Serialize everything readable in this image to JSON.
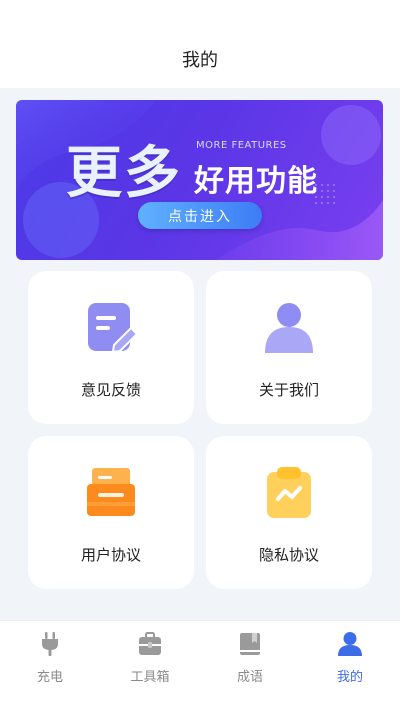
{
  "header": {
    "title": "我的"
  },
  "banner": {
    "big_text": "更多",
    "en_text": "MORE FEATURES",
    "sub_text": "好用功能",
    "button_label": "点击进入"
  },
  "cards": [
    {
      "label": "意见反馈",
      "icon": "feedback-icon"
    },
    {
      "label": "关于我们",
      "icon": "user-icon"
    },
    {
      "label": "用户协议",
      "icon": "archive-box-icon"
    },
    {
      "label": "隐私协议",
      "icon": "clipboard-chart-icon"
    }
  ],
  "tabbar": {
    "items": [
      {
        "label": "充电",
        "icon": "plug-icon",
        "active": false
      },
      {
        "label": "工具箱",
        "icon": "toolbox-icon",
        "active": false
      },
      {
        "label": "成语",
        "icon": "book-icon",
        "active": false
      },
      {
        "label": "我的",
        "icon": "person-icon",
        "active": true
      }
    ]
  },
  "colors": {
    "accent": "#3d6ce9",
    "inactive": "#8a8a8a",
    "background": "#f1f4f9"
  }
}
